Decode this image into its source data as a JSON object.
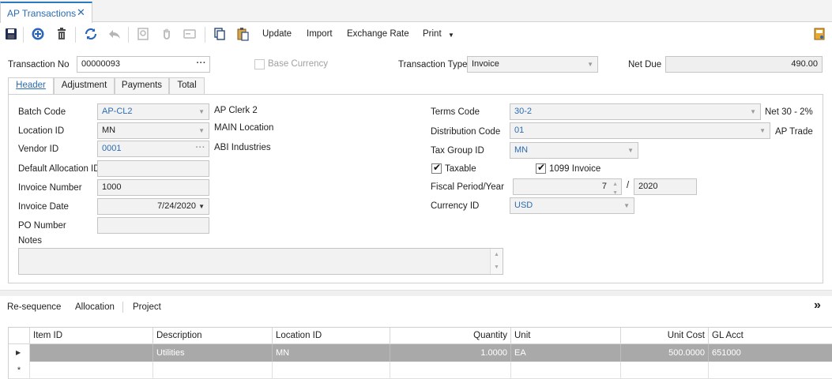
{
  "tab": {
    "title": "AP Transactions",
    "close": "✕"
  },
  "toolbar": {
    "update": "Update",
    "import": "Import",
    "exchange_rate": "Exchange Rate",
    "print": "Print"
  },
  "top": {
    "transaction_no_label": "Transaction No",
    "transaction_no": "00000093",
    "base_currency_label": "Base Currency",
    "transaction_type_label": "Transaction Type",
    "transaction_type": "Invoice",
    "net_due_label": "Net Due",
    "net_due": "490.00"
  },
  "subtabs": [
    "Header",
    "Adjustment",
    "Payments",
    "Total"
  ],
  "header": {
    "batch_code_label": "Batch Code",
    "batch_code": "AP-CL2",
    "batch_code_desc": "AP Clerk 2",
    "location_id_label": "Location ID",
    "location_id": "MN",
    "location_desc": "MAIN Location",
    "vendor_id_label": "Vendor ID",
    "vendor_id": "0001",
    "vendor_desc": "ABI Industries",
    "default_allocation_label": "Default Allocation ID",
    "default_allocation": "",
    "invoice_number_label": "Invoice Number",
    "invoice_number": "1000",
    "invoice_date_label": "Invoice Date",
    "invoice_date": "7/24/2020",
    "po_number_label": "PO Number",
    "po_number": "",
    "notes_label": "Notes",
    "notes": "",
    "terms_code_label": "Terms Code",
    "terms_code": "30-2",
    "terms_desc": "Net 30 - 2%",
    "distribution_code_label": "Distribution Code",
    "distribution_code": "01",
    "distribution_desc": "AP Trade",
    "tax_group_label": "Tax Group ID",
    "tax_group": "MN",
    "taxable_label": "Taxable",
    "taxable_checked": true,
    "invoice_1099_label": "1099 Invoice",
    "invoice_1099_checked": true,
    "fiscal_label": "Fiscal Period/Year",
    "fiscal_period": "7",
    "fiscal_sep": "/",
    "fiscal_year": "2020",
    "currency_label": "Currency ID",
    "currency": "USD"
  },
  "actions": {
    "resequence": "Re-sequence",
    "allocation": "Allocation",
    "project": "Project",
    "expand": "»"
  },
  "grid": {
    "columns": [
      "Item ID",
      "Description",
      "Location ID",
      "Quantity",
      "Unit",
      "Unit Cost",
      "GL Acct"
    ],
    "rows": [
      {
        "item_id": "",
        "description": "Utilities",
        "location_id": "MN",
        "quantity": "1.0000",
        "unit": "EA",
        "unit_cost": "500.0000",
        "gl_acct": "651000"
      }
    ],
    "new_row_marker": "*"
  },
  "colors": {
    "accent": "#2b6cb3",
    "selected_row": "#a9a9a9"
  }
}
